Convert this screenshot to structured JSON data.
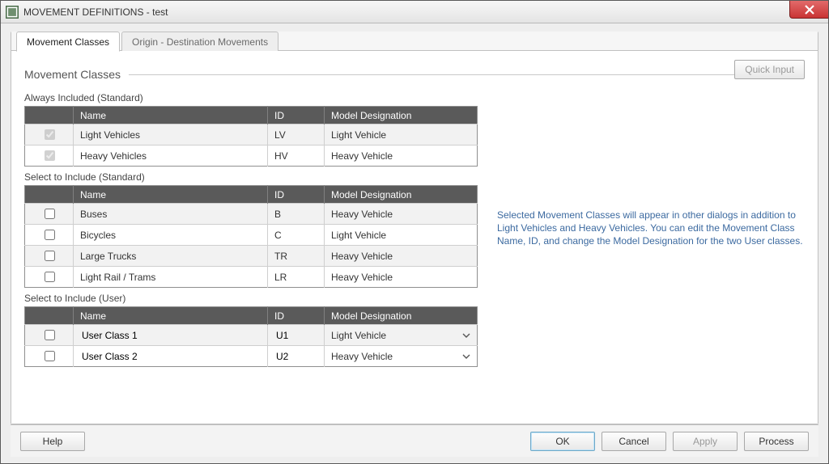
{
  "window": {
    "title": "MOVEMENT DEFINITIONS - test"
  },
  "tabs": {
    "movement_classes": "Movement Classes",
    "od_movements": "Origin - Destination Movements"
  },
  "quick_input_label": "Quick Input",
  "section_title": "Movement Classes",
  "groups": {
    "always": {
      "label": "Always Included (Standard)",
      "cols": {
        "name": "Name",
        "id": "ID",
        "md": "Model Designation"
      },
      "rows": [
        {
          "checked": true,
          "name": "Light Vehicles",
          "id": "LV",
          "md": "Light Vehicle"
        },
        {
          "checked": true,
          "name": "Heavy Vehicles",
          "id": "HV",
          "md": "Heavy Vehicle"
        }
      ]
    },
    "select_std": {
      "label": "Select to Include (Standard)",
      "cols": {
        "name": "Name",
        "id": "ID",
        "md": "Model Designation"
      },
      "rows": [
        {
          "checked": false,
          "name": "Buses",
          "id": "B",
          "md": "Heavy Vehicle"
        },
        {
          "checked": false,
          "name": "Bicycles",
          "id": "C",
          "md": "Light Vehicle"
        },
        {
          "checked": false,
          "name": "Large Trucks",
          "id": "TR",
          "md": "Heavy Vehicle"
        },
        {
          "checked": false,
          "name": "Light Rail / Trams",
          "id": "LR",
          "md": "Heavy Vehicle"
        }
      ]
    },
    "select_user": {
      "label": "Select to Include (User)",
      "cols": {
        "name": "Name",
        "id": "ID",
        "md": "Model Designation"
      },
      "rows": [
        {
          "checked": false,
          "name": "User Class 1",
          "id": "U1",
          "md": "Light Vehicle"
        },
        {
          "checked": false,
          "name": "User Class 2",
          "id": "U2",
          "md": "Heavy Vehicle"
        }
      ]
    }
  },
  "info_text": "Selected Movement Classes will appear in other dialogs in addition to Light Vehicles and Heavy Vehicles. You can edit the Movement Class Name, ID, and change the Model Designation for the two User classes.",
  "footer": {
    "help": "Help",
    "ok": "OK",
    "cancel": "Cancel",
    "apply": "Apply",
    "process": "Process"
  }
}
